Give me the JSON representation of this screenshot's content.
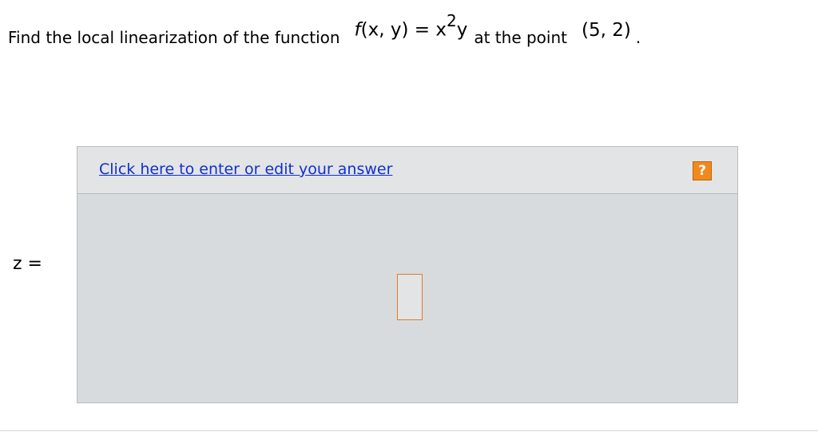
{
  "question": {
    "prefix": "Find the local linearization of the function",
    "function_name": "f",
    "function_args": "(x, y)",
    "equals": " = ",
    "base": "x",
    "exponent": "2",
    "factor": "y",
    "middle": "at the point",
    "point": "(5, 2)",
    "period": "."
  },
  "answer": {
    "variable_label": "z =",
    "edit_link_label": "Click here to enter or edit your answer",
    "help_icon_label": "?"
  },
  "colors": {
    "link": "#1030d0",
    "help_icon": "#f08a1e",
    "input_border": "#e07b2a",
    "answer_area": "#d8dbdd"
  }
}
